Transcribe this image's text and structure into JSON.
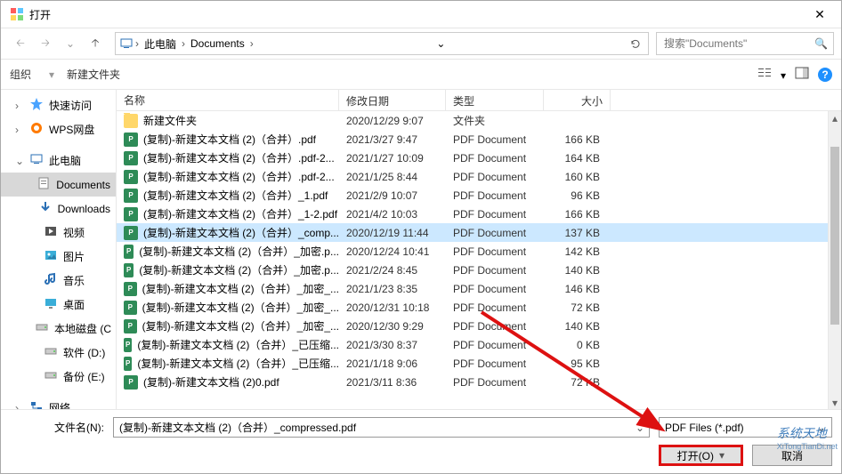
{
  "window": {
    "title": "打开"
  },
  "nav": {
    "path": [
      "此电脑",
      "Documents"
    ],
    "search_placeholder": "搜索\"Documents\""
  },
  "toolbar": {
    "organize": "组织",
    "new_folder": "新建文件夹"
  },
  "sidebar": {
    "items": [
      {
        "label": "快速访问",
        "icon": "star",
        "color": "#4aa3ff"
      },
      {
        "label": "WPS网盘",
        "icon": "wps",
        "color": "#ff7a00"
      },
      {
        "label": "此电脑",
        "icon": "pc",
        "color": "#2a6fb5",
        "expanded": true
      },
      {
        "label": "Documents",
        "icon": "doc",
        "sub": true,
        "selected": true
      },
      {
        "label": "Downloads",
        "icon": "down",
        "sub": true
      },
      {
        "label": "视频",
        "icon": "video",
        "sub": true
      },
      {
        "label": "图片",
        "icon": "pic",
        "sub": true
      },
      {
        "label": "音乐",
        "icon": "music",
        "sub": true
      },
      {
        "label": "桌面",
        "icon": "desk",
        "sub": true
      },
      {
        "label": "本地磁盘 (C",
        "icon": "disk",
        "sub": true
      },
      {
        "label": "软件 (D:)",
        "icon": "disk",
        "sub": true
      },
      {
        "label": "备份 (E:)",
        "icon": "disk",
        "sub": true
      },
      {
        "label": "网络",
        "icon": "net",
        "color": "#2a6fb5"
      }
    ]
  },
  "columns": {
    "name": "名称",
    "date": "修改日期",
    "type": "类型",
    "size": "大小"
  },
  "files": [
    {
      "name": "新建文件夹",
      "date": "2020/12/29 9:07",
      "type": "文件夹",
      "size": "",
      "icon": "folder"
    },
    {
      "name": "(复制)-新建文本文档 (2)（合并）.pdf",
      "date": "2021/3/27 9:47",
      "type": "PDF Document",
      "size": "166 KB",
      "icon": "pdf"
    },
    {
      "name": "(复制)-新建文本文档 (2)（合并）.pdf-2...",
      "date": "2021/1/27 10:09",
      "type": "PDF Document",
      "size": "164 KB",
      "icon": "pdf"
    },
    {
      "name": "(复制)-新建文本文档 (2)（合并）.pdf-2...",
      "date": "2021/1/25 8:44",
      "type": "PDF Document",
      "size": "160 KB",
      "icon": "pdf"
    },
    {
      "name": "(复制)-新建文本文档 (2)（合并）_1.pdf",
      "date": "2021/2/9 10:07",
      "type": "PDF Document",
      "size": "96 KB",
      "icon": "pdf"
    },
    {
      "name": "(复制)-新建文本文档 (2)（合并）_1-2.pdf",
      "date": "2021/4/2 10:03",
      "type": "PDF Document",
      "size": "166 KB",
      "icon": "pdf"
    },
    {
      "name": "(复制)-新建文本文档 (2)（合并）_comp...",
      "date": "2020/12/19 11:44",
      "type": "PDF Document",
      "size": "137 KB",
      "icon": "pdf",
      "selected": true
    },
    {
      "name": "(复制)-新建文本文档 (2)（合并）_加密.p...",
      "date": "2020/12/24 10:41",
      "type": "PDF Document",
      "size": "142 KB",
      "icon": "pdf"
    },
    {
      "name": "(复制)-新建文本文档 (2)（合并）_加密.p...",
      "date": "2021/2/24 8:45",
      "type": "PDF Document",
      "size": "140 KB",
      "icon": "pdf"
    },
    {
      "name": "(复制)-新建文本文档 (2)（合并）_加密_...",
      "date": "2021/1/23 8:35",
      "type": "PDF Document",
      "size": "146 KB",
      "icon": "pdf"
    },
    {
      "name": "(复制)-新建文本文档 (2)（合并）_加密_...",
      "date": "2020/12/31 10:18",
      "type": "PDF Document",
      "size": "72 KB",
      "icon": "pdf"
    },
    {
      "name": "(复制)-新建文本文档 (2)（合并）_加密_...",
      "date": "2020/12/30 9:29",
      "type": "PDF Document",
      "size": "140 KB",
      "icon": "pdf"
    },
    {
      "name": "(复制)-新建文本文档 (2)（合并）_已压缩...",
      "date": "2021/3/30 8:37",
      "type": "PDF Document",
      "size": "0 KB",
      "icon": "pdf"
    },
    {
      "name": "(复制)-新建文本文档 (2)（合并）_已压缩...",
      "date": "2021/1/18 9:06",
      "type": "PDF Document",
      "size": "95 KB",
      "icon": "pdf"
    },
    {
      "name": "(复制)-新建文本文档 (2)0.pdf",
      "date": "2021/3/11 8:36",
      "type": "PDF Document",
      "size": "72 KB",
      "icon": "pdf"
    }
  ],
  "footer": {
    "filename_label": "文件名(N):",
    "filename_value": "(复制)-新建文本文档 (2)（合并）_compressed.pdf",
    "filter": "PDF Files (*.pdf)",
    "open": "打开(O)",
    "cancel": "取消"
  },
  "watermark": {
    "main": "系统天地",
    "sub": "XiTongTianDi.net"
  }
}
